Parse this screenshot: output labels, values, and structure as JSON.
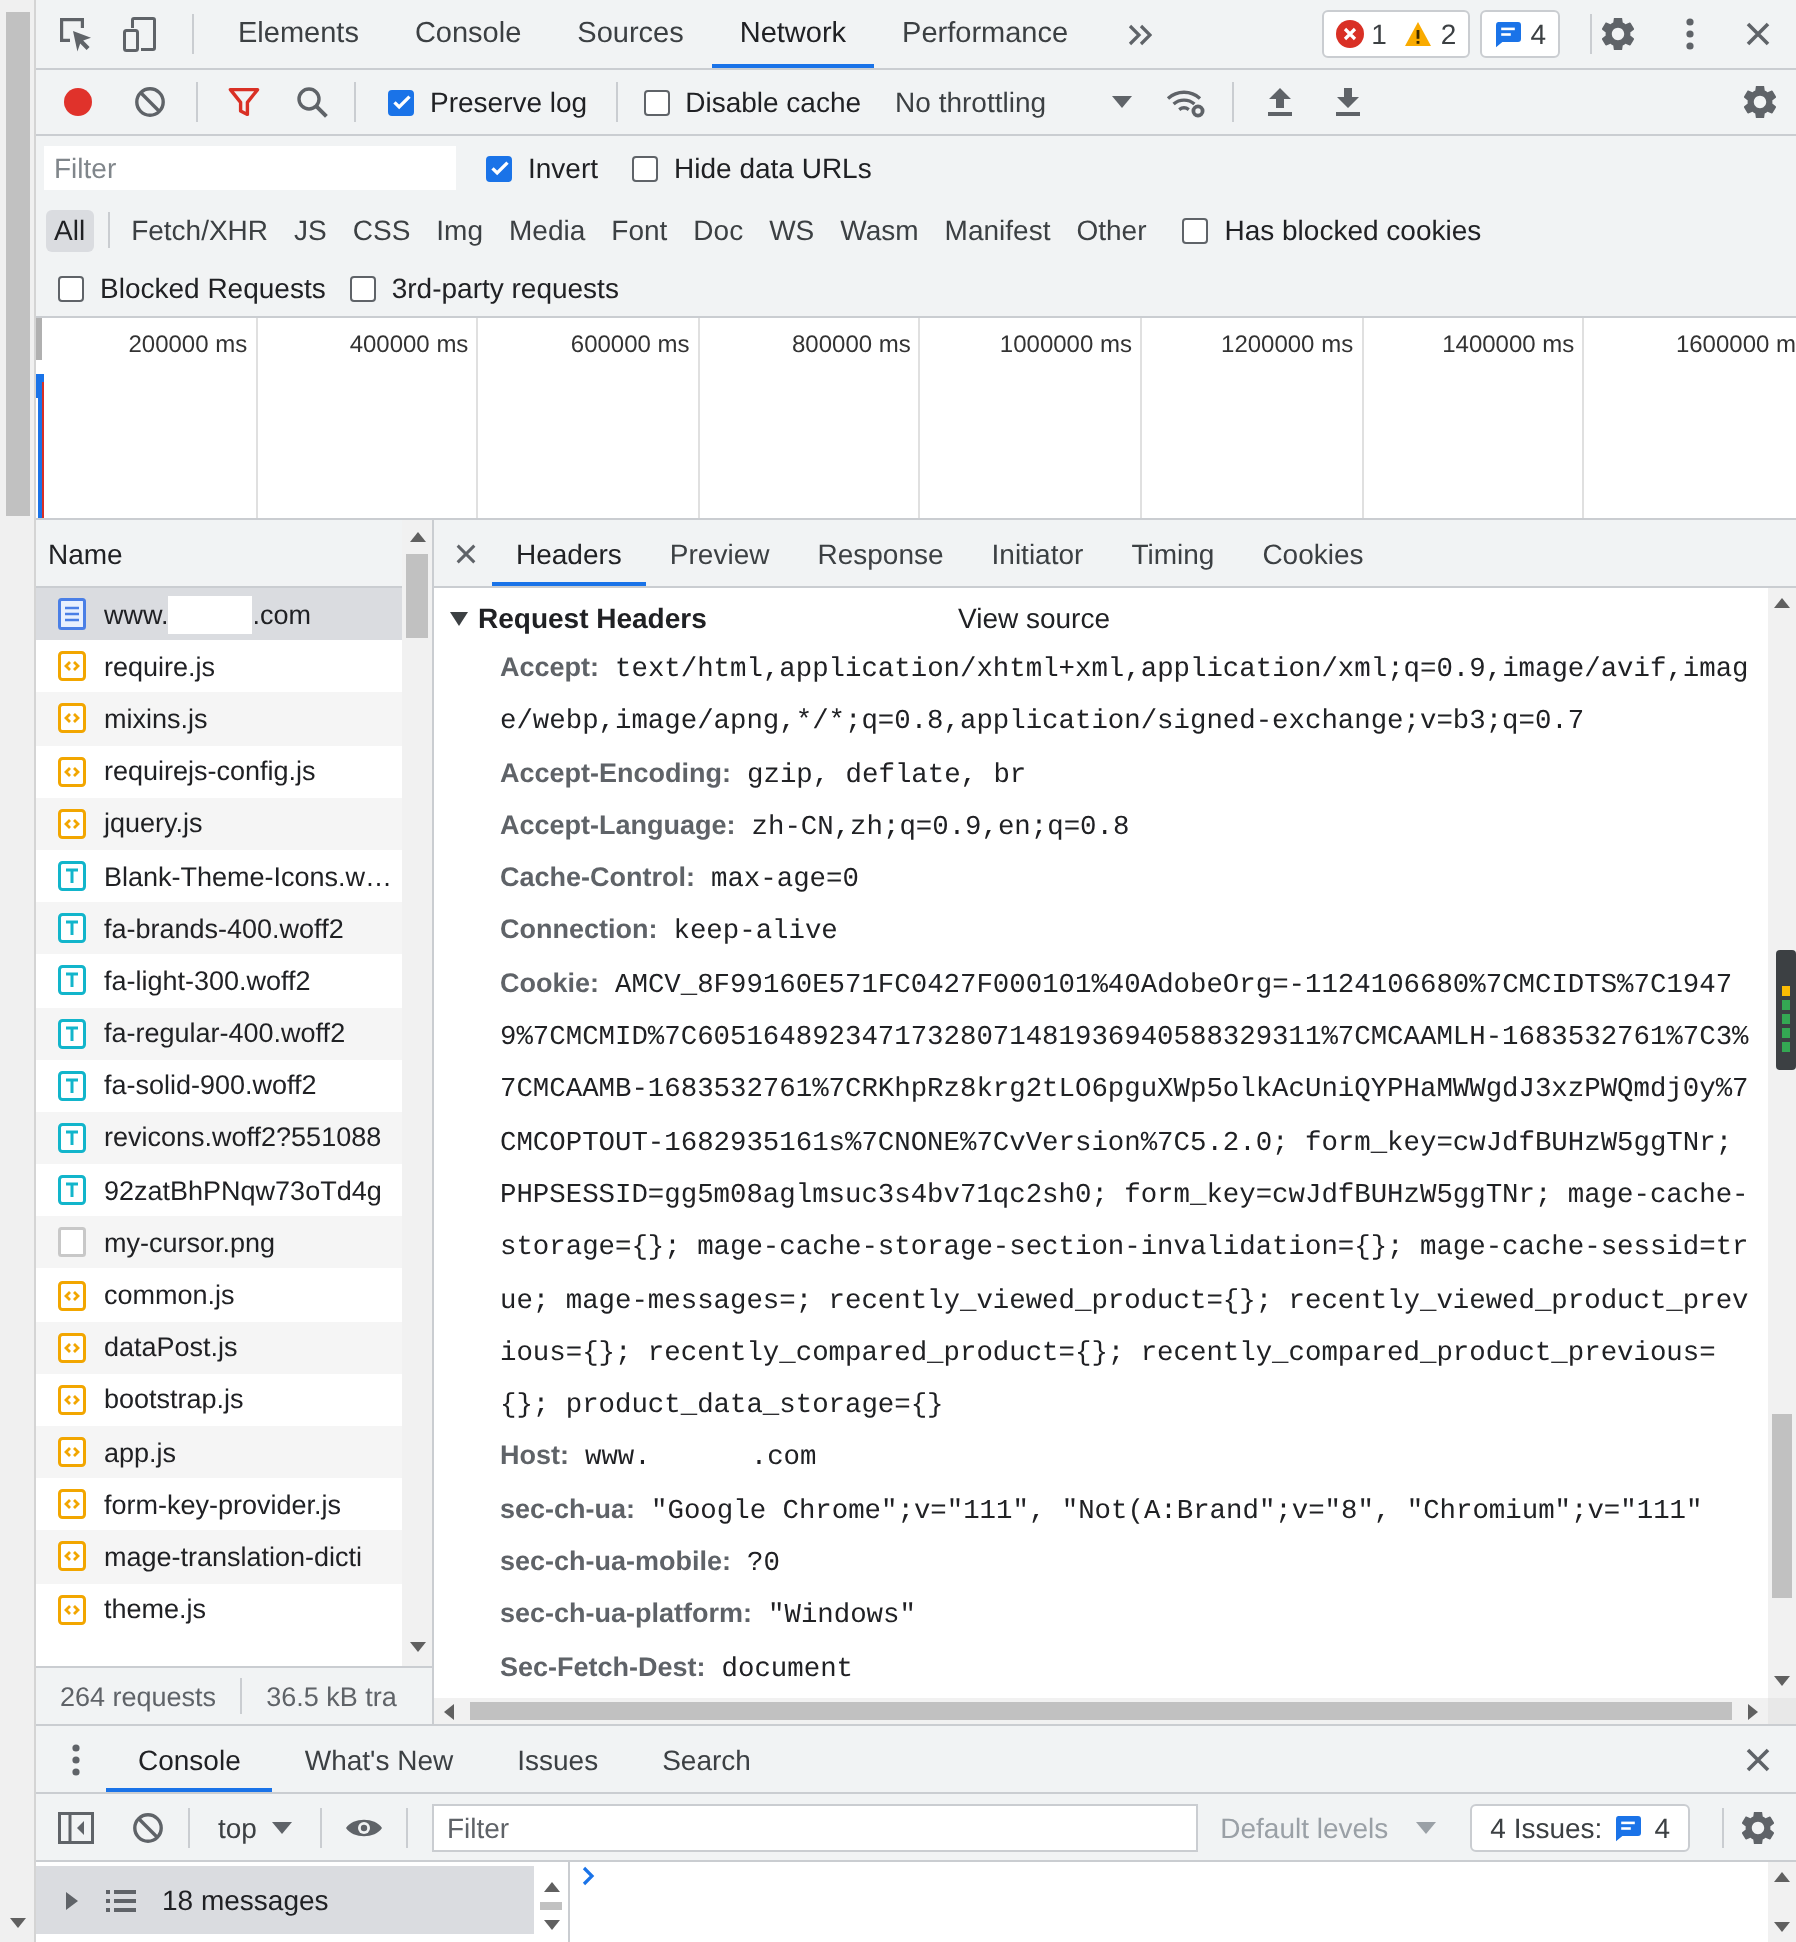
{
  "main_tabs": {
    "tabs": [
      {
        "label": "Elements",
        "selected": false
      },
      {
        "label": "Console",
        "selected": false
      },
      {
        "label": "Sources",
        "selected": false
      },
      {
        "label": "Network",
        "selected": true
      },
      {
        "label": "Performance",
        "selected": false
      }
    ],
    "errors": "1",
    "warnings": "2",
    "issues": "4"
  },
  "network_toolbar": {
    "recording": true,
    "filter_active": true,
    "options": [
      {
        "label": "Preserve log",
        "checked": true
      },
      {
        "label": "Disable cache",
        "checked": false
      }
    ],
    "throttling": "No throttling"
  },
  "filter_bar": {
    "placeholder": "Filter",
    "options": [
      {
        "label": "Invert",
        "checked": true
      },
      {
        "label": "Hide data URLs",
        "checked": false
      }
    ],
    "types": [
      {
        "label": "All",
        "selected": true
      },
      {
        "label": "Fetch/XHR",
        "selected": false
      },
      {
        "label": "JS",
        "selected": false
      },
      {
        "label": "CSS",
        "selected": false
      },
      {
        "label": "Img",
        "selected": false
      },
      {
        "label": "Media",
        "selected": false
      },
      {
        "label": "Font",
        "selected": false
      },
      {
        "label": "Doc",
        "selected": false
      },
      {
        "label": "WS",
        "selected": false
      },
      {
        "label": "Wasm",
        "selected": false
      },
      {
        "label": "Manifest",
        "selected": false
      },
      {
        "label": "Other",
        "selected": false
      }
    ],
    "type_options": [
      {
        "label": "Has blocked cookies",
        "checked": false
      }
    ],
    "extra_options": [
      {
        "label": "Blocked Requests",
        "checked": false
      },
      {
        "label": "3rd-party requests",
        "checked": false
      }
    ]
  },
  "overview": {
    "ticks": [
      "200000 ms",
      "400000 ms",
      "600000 ms",
      "800000 ms",
      "1000000 ms",
      "1200000 ms",
      "1400000 ms",
      "1600000 m"
    ]
  },
  "requests": {
    "column": "Name",
    "items": [
      {
        "kind": "document",
        "name": "www.",
        "name_end": ".com",
        "selected": true
      },
      {
        "kind": "script",
        "name": "require.js",
        "selected": false
      },
      {
        "kind": "script",
        "name": "mixins.js",
        "selected": false
      },
      {
        "kind": "script",
        "name": "requirejs-config.js",
        "selected": false
      },
      {
        "kind": "script",
        "name": "jquery.js",
        "selected": false
      },
      {
        "kind": "font",
        "name": "Blank-Theme-Icons.w…",
        "selected": false
      },
      {
        "kind": "font",
        "name": "fa-brands-400.woff2",
        "selected": false
      },
      {
        "kind": "font",
        "name": "fa-light-300.woff2",
        "selected": false
      },
      {
        "kind": "font",
        "name": "fa-regular-400.woff2",
        "selected": false
      },
      {
        "kind": "font",
        "name": "fa-solid-900.woff2",
        "selected": false
      },
      {
        "kind": "font",
        "name": "revicons.woff2?551088",
        "selected": false
      },
      {
        "kind": "font",
        "name": "92zatBhPNqw73oTd4g",
        "selected": false
      },
      {
        "kind": "image",
        "name": "my-cursor.png",
        "selected": false
      },
      {
        "kind": "script",
        "name": "common.js",
        "selected": false
      },
      {
        "kind": "script",
        "name": "dataPost.js",
        "selected": false
      },
      {
        "kind": "script",
        "name": "bootstrap.js",
        "selected": false
      },
      {
        "kind": "script",
        "name": "app.js",
        "selected": false
      },
      {
        "kind": "script",
        "name": "form-key-provider.js",
        "selected": false
      },
      {
        "kind": "script",
        "name": "mage-translation-dicti",
        "selected": false
      },
      {
        "kind": "script",
        "name": "theme.js",
        "selected": false
      }
    ],
    "summary": [
      "264 requests",
      "36.5 kB tra"
    ]
  },
  "details": {
    "tabs": [
      {
        "label": "Headers",
        "selected": true
      },
      {
        "label": "Preview",
        "selected": false
      },
      {
        "label": "Response",
        "selected": false
      },
      {
        "label": "Initiator",
        "selected": false
      },
      {
        "label": "Timing",
        "selected": false
      },
      {
        "label": "Cookies",
        "selected": false
      }
    ],
    "section": {
      "title": "Request Headers",
      "expanded": true,
      "link": "View source"
    },
    "headers": [
      {
        "name": "Accept:",
        "value": "text/html,application/xhtml+xml,application/xml;q=0.9,image/avif,image/webp,image/apng,*/*;q=0.8,application/signed-exchange;v=b3;q=0.7"
      },
      {
        "name": "Accept-Encoding:",
        "value": "gzip, deflate, br"
      },
      {
        "name": "Accept-Language:",
        "value": "zh-CN,zh;q=0.9,en;q=0.8"
      },
      {
        "name": "Cache-Control:",
        "value": "max-age=0"
      },
      {
        "name": "Connection:",
        "value": "keep-alive"
      },
      {
        "name": "Cookie:",
        "value": "AMCV_8F99160E571FC0427F000101%40AdobeOrg=-1124106680%7CMCIDTS%7C19479%7CMCMID%7C60516489234717328071481936940588329311%7CMCAAMLH-1683532761%7C3%7CMCAAMB-1683532761%7CRKhpRz8krg2tLO6pguXWp5olkAcUniQYPHaMWWgdJ3xzPWQmdj0y%7CMCOPTOUT-1682935161s%7CNONE%7CvVersion%7C5.2.0; form_key=cwJdfBUHzW5ggTNr; PHPSESSID=gg5m08aglmsuc3s4bv71qc2sh0; form_key=cwJdfBUHzW5ggTNr; mage-cache-storage={}; mage-cache-storage-section-invalidation={}; mage-cache-sessid=true; mage-messages=; recently_viewed_product={}; recently_viewed_product_previous={}; recently_compared_product={}; recently_compared_product_previous={}; product_data_storage={}"
      },
      {
        "name": "Host:",
        "value": "www.",
        "value_end": ".com"
      },
      {
        "name": "sec-ch-ua:",
        "value": "\"Google Chrome\";v=\"111\", \"Not(A:Brand\";v=\"8\", \"Chromium\";v=\"111\""
      },
      {
        "name": "sec-ch-ua-mobile:",
        "value": "?0"
      },
      {
        "name": "sec-ch-ua-platform:",
        "value": "\"Windows\""
      },
      {
        "name": "Sec-Fetch-Dest:",
        "value": "document"
      }
    ]
  },
  "drawer": {
    "tabs": [
      {
        "label": "Console",
        "selected": true
      },
      {
        "label": "What's New",
        "selected": false
      },
      {
        "label": "Issues",
        "selected": false
      },
      {
        "label": "Search",
        "selected": false
      }
    ],
    "context": "top",
    "placeholder": "Filter",
    "levels": {
      "label": "Default levels",
      "disabled": true
    },
    "issues_label": "4 Issues:",
    "issues_count": "4",
    "sidebar": {
      "label": "18 messages",
      "expanded": false,
      "selected": true
    }
  }
}
